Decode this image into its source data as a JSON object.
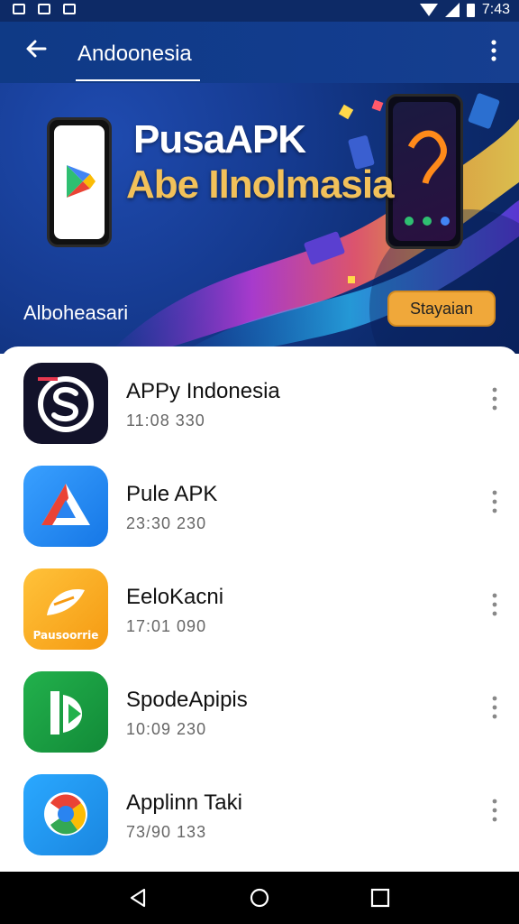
{
  "status_bar": {
    "time": "7:43"
  },
  "header": {
    "title": "Andoonesia"
  },
  "banner": {
    "headline_line1": "PusaAPK",
    "headline_line2": "Abe Ilnolmasia",
    "subtitle": "Alboheasari",
    "button_label": "Stayaian"
  },
  "apps": [
    {
      "name": "APPy Indonesia",
      "meta": "11:08 330"
    },
    {
      "name": "Pule APK",
      "meta": "23:30 230"
    },
    {
      "name": "EeloKacni",
      "meta": "17:01 090"
    },
    {
      "name": "SpodeApipis",
      "meta": "10:09 230"
    },
    {
      "name": "Applinn Taki",
      "meta": "73/90 133"
    }
  ],
  "app_icon_text": {
    "third": "Pausoorrie"
  },
  "colors": {
    "topbar": "#123c8d",
    "banner_button": "#f0a83a",
    "headline_accent": "#f2c15a"
  },
  "icons": [
    "back-arrow-icon",
    "more-vert-icon",
    "play-store-icon",
    "nav-back-icon",
    "nav-home-icon",
    "nav-recents-icon",
    "wifi-icon",
    "signal-icon",
    "battery-icon"
  ]
}
